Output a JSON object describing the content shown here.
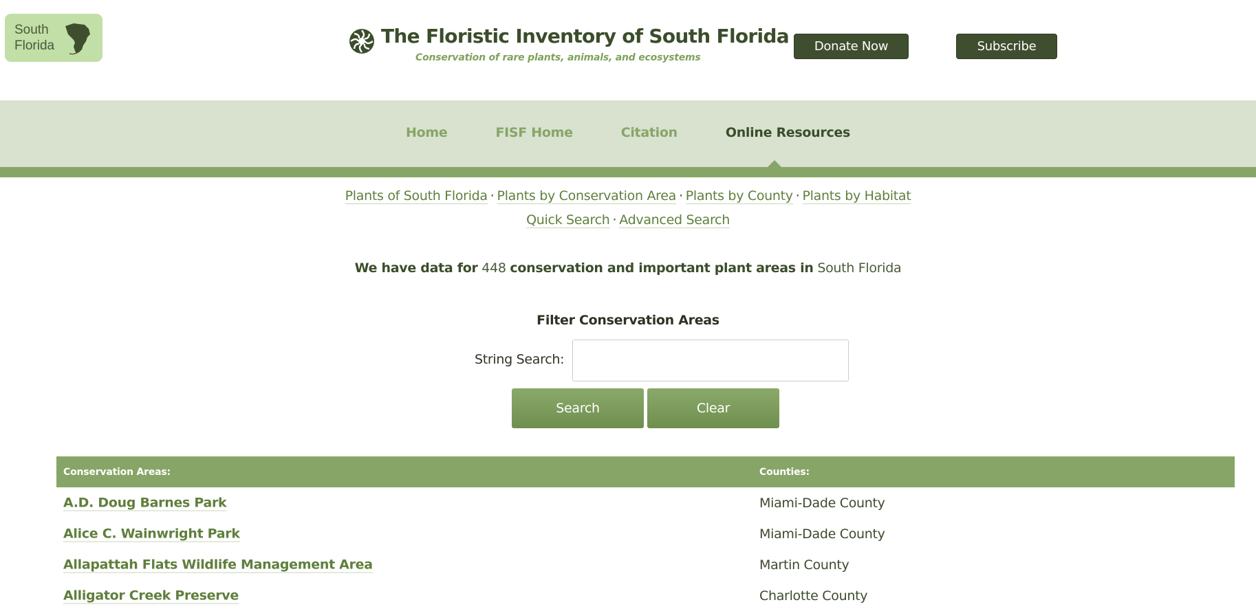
{
  "header": {
    "logo_line1": "South",
    "logo_line2": "Florida",
    "title": "The Floristic Inventory of South Florida",
    "subtitle": "Conservation of rare plants, animals, and ecosystems",
    "donate_label": "Donate Now",
    "subscribe_label": "Subscribe"
  },
  "nav": {
    "items": [
      {
        "label": "Home",
        "active": false
      },
      {
        "label": "FISF Home",
        "active": false
      },
      {
        "label": "Citation",
        "active": false
      },
      {
        "label": "Online Resources",
        "active": true
      }
    ]
  },
  "sublinks": {
    "row1": [
      "Plants of South Florida",
      "Plants by Conservation Area",
      "Plants by County",
      "Plants by Habitat"
    ],
    "row2": [
      "Quick Search",
      "Advanced Search"
    ],
    "separator": "·"
  },
  "stat": {
    "prefix": "We have data for",
    "count": "448",
    "middle": "conservation and important plant areas in",
    "region": "South Florida"
  },
  "filter": {
    "heading": "Filter Conservation Areas",
    "label": "String Search:",
    "input_value": "",
    "search_label": "Search",
    "clear_label": "Clear"
  },
  "table": {
    "headers": [
      "Conservation Areas:",
      "Counties:"
    ],
    "rows": [
      {
        "area": "A.D. Doug Barnes Park",
        "county": "Miami-Dade County"
      },
      {
        "area": "Alice C. Wainwright Park",
        "county": "Miami-Dade County"
      },
      {
        "area": "Allapattah Flats Wildlife Management Area",
        "county": "Martin County"
      },
      {
        "area": "Alligator Creek Preserve",
        "county": "Charlotte County"
      }
    ]
  },
  "colors": {
    "accent_green": "#87a566",
    "dark_green": "#3e4e2f",
    "nav_band": "#d8e2cf",
    "logo_bg": "#c1dfa6"
  },
  "icons": {
    "logo": "florida-map-icon",
    "title": "flower-seal-icon"
  }
}
